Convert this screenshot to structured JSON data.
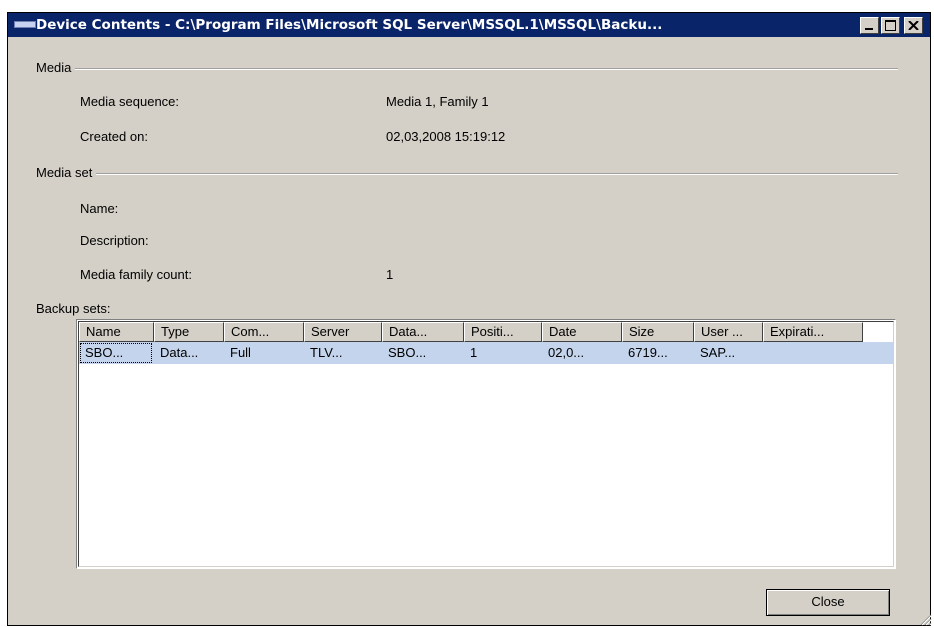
{
  "window": {
    "title": "Device Contents - C:\\Program Files\\Microsoft SQL Server\\MSSQL.1\\MSSQL\\Backu...",
    "controls": [
      "minimize-icon",
      "maximize-icon",
      "close-icon"
    ]
  },
  "media": {
    "group_label": "Media",
    "sequence_label": "Media sequence:",
    "sequence_value": "Media 1, Family 1",
    "created_label": "Created on:",
    "created_value": "02,03,2008 15:19:12"
  },
  "media_set": {
    "group_label": "Media set",
    "name_label": "Name:",
    "description_label": "Description:",
    "family_count_label": "Media family count:",
    "family_count_value": "1"
  },
  "backup_sets": {
    "label": "Backup sets:",
    "columns": [
      "Name",
      "Type",
      "Com...",
      "Server",
      "Data...",
      "Positi...",
      "Date",
      "Size",
      "User ...",
      "Expirati..."
    ],
    "rows": [
      [
        "SBO...",
        "Data...",
        "Full",
        "TLV...",
        "SBO...",
        "1",
        "02,0...",
        "6719...",
        "SAP...",
        ""
      ]
    ],
    "selected_row_color": "#c4d4ec"
  },
  "buttons": {
    "close_label": "Close"
  },
  "colors": {
    "titlebar": "#0a246a",
    "dialog_bg": "#d4d0c8"
  }
}
